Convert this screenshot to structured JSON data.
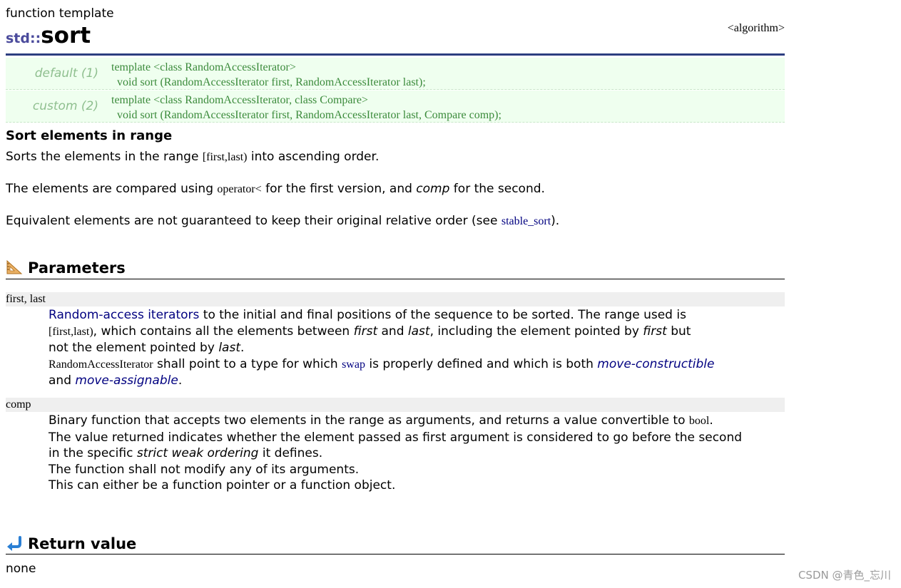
{
  "page": {
    "kind": "function template",
    "namespace": "std::",
    "name": "sort",
    "header": "<algorithm>"
  },
  "prototypes": [
    {
      "label": "default (1)",
      "line1": "template <class RandomAccessIterator>",
      "line2": "  void sort (RandomAccessIterator first, RandomAccessIterator last);"
    },
    {
      "label": "custom (2)",
      "line1": "template <class RandomAccessIterator, class Compare>",
      "line2": "  void sort (RandomAccessIterator first, RandomAccessIterator last, Compare comp);"
    }
  ],
  "summary": {
    "heading": "Sort elements in range",
    "p1_a": "Sorts the elements in the range ",
    "p1_code": "[first,last)",
    "p1_b": " into ascending order.",
    "p2_a": "The elements are compared using ",
    "p2_code": "operator<",
    "p2_b": " for the first version, and ",
    "p2_em": "comp",
    "p2_c": " for the second.",
    "p3_a": "Equivalent elements are not guaranteed to keep their original relative order (see ",
    "p3_link": "stable_sort",
    "p3_b": ")."
  },
  "parameters": {
    "heading": "Parameters",
    "icon": "ruler-triangle-icon",
    "first_last_name": "first, last",
    "fl_link": "Random-access iterators",
    "fl_1": " to the initial and final positions of the sequence to be sorted. The range used is",
    "fl_code1": "[first,last)",
    "fl_2": ", which contains all the elements between ",
    "fl_em1": "first",
    "fl_3": " and ",
    "fl_em2": "last",
    "fl_4": ", including the element pointed by ",
    "fl_em3": "first",
    "fl_5": " but",
    "fl_6": "not the element pointed by ",
    "fl_em4": "last",
    "fl_7": ".",
    "fl_code2": "RandomAccessIterator",
    "fl_8": " shall point to a type for which ",
    "fl_code3": "swap",
    "fl_9": " is properly defined and which is both ",
    "fl_link2": "move-constructible",
    "fl_10": "and ",
    "fl_link3": "move-assignable",
    "fl_11": ".",
    "comp_name": "comp",
    "comp_1": "Binary function that accepts two elements in the range as arguments, and returns a value convertible to ",
    "comp_code": "bool",
    "comp_2": ".",
    "comp_3": "The value returned indicates whether the element passed as first argument is considered to go before the second",
    "comp_4": "in the specific ",
    "comp_em": "strict weak ordering",
    "comp_5": " it defines.",
    "comp_6": "The function shall not modify any of its arguments.",
    "comp_7": "This can either be a function pointer or a function object."
  },
  "return_value": {
    "heading": "Return value",
    "icon": "return-arrow-icon",
    "text": "none"
  },
  "watermark": "CSDN @青色_忘川"
}
